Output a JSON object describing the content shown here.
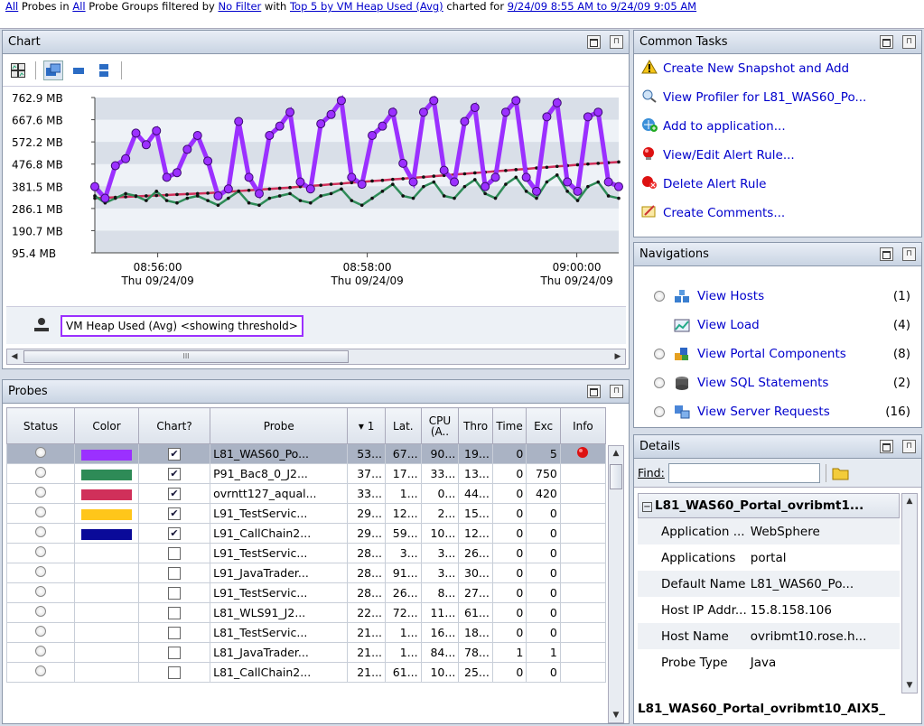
{
  "topbar": {
    "t1": "All",
    "t2": " Probes in ",
    "t3": "All",
    "t4": " Probe Groups filtered by ",
    "t5": "No Filter",
    "t6": " with ",
    "t7": "Top 5 by VM Heap Used (Avg)",
    "t8": " charted for ",
    "t9": "9/24/09 8:55 AM to 9/24/09 9:05 AM"
  },
  "chart_panel": {
    "title": "Chart",
    "legend_label": "VM Heap Used (Avg) <showing threshold>",
    "scroll_grip": "III"
  },
  "chart_data": {
    "type": "line",
    "y_ticks": [
      "762.9 MB",
      "667.6 MB",
      "572.2 MB",
      "476.8 MB",
      "381.5 MB",
      "286.1 MB",
      "190.7 MB",
      "95.4 MB"
    ],
    "x_ticks": [
      {
        "time": "08:56:00",
        "date": "Thu 09/24/09"
      },
      {
        "time": "08:58:00",
        "date": "Thu 09/24/09"
      },
      {
        "time": "09:00:00",
        "date": "Thu 09/24/09"
      }
    ],
    "ylim_mb": [
      95.4,
      762.9
    ],
    "x_range": [
      "08:55:00",
      "09:05:00"
    ],
    "series": [
      {
        "color": "#9b30ff",
        "values": [
          380,
          330,
          470,
          500,
          610,
          560,
          620,
          420,
          440,
          540,
          600,
          490,
          340,
          370,
          660,
          420,
          350,
          600,
          640,
          700,
          400,
          370,
          650,
          690,
          750,
          420,
          390,
          600,
          640,
          700,
          480,
          400,
          700,
          750,
          450,
          400,
          660,
          720,
          380,
          420,
          700,
          750,
          420,
          360,
          680,
          740,
          400,
          360,
          680,
          700,
          400,
          380
        ]
      },
      {
        "color": "#2e8b57",
        "values": [
          340,
          310,
          330,
          350,
          340,
          320,
          360,
          320,
          310,
          330,
          340,
          320,
          300,
          330,
          360,
          310,
          300,
          330,
          340,
          350,
          320,
          310,
          340,
          350,
          370,
          320,
          300,
          330,
          360,
          390,
          340,
          330,
          380,
          400,
          340,
          330,
          380,
          410,
          350,
          330,
          390,
          420,
          360,
          330,
          400,
          430,
          360,
          320,
          380,
          400,
          340,
          330
        ]
      },
      {
        "color": "#d0305a",
        "values": [
          330,
          332,
          334,
          336,
          338,
          340,
          342,
          344,
          346,
          348,
          350,
          352,
          355,
          358,
          361,
          364,
          367,
          370,
          373,
          376,
          380,
          383,
          386,
          390,
          393,
          397,
          400,
          404,
          407,
          411,
          414,
          418,
          421,
          425,
          428,
          432,
          435,
          439,
          442,
          446,
          449,
          453,
          456,
          460,
          463,
          467,
          470,
          474,
          477,
          480,
          483,
          486
        ]
      }
    ]
  },
  "probes_panel": {
    "title": "Probes",
    "columns": [
      "Status",
      "Color",
      "Chart?",
      "Probe",
      "1",
      "Lat.",
      "CPU (A..",
      "Thro",
      "Time",
      "Exc",
      "Info"
    ],
    "rows": [
      {
        "color": "#9b30ff",
        "checked": true,
        "probe": "L81_WAS60_Po...",
        "v1": "53...",
        "lat": "67...",
        "cpu": "90...",
        "thr": "19...",
        "time": "0",
        "exc": "5",
        "info": true,
        "sel": true
      },
      {
        "color": "#2e8b57",
        "checked": true,
        "probe": "P91_Bac8_0_J2...",
        "v1": "37...",
        "lat": "17...",
        "cpu": "33...",
        "thr": "13...",
        "time": "0",
        "exc": "750"
      },
      {
        "color": "#d0305a",
        "checked": true,
        "probe": "ovrntt127_aqual...",
        "v1": "33...",
        "lat": "1...",
        "cpu": "0...",
        "thr": "44...",
        "time": "0",
        "exc": "420"
      },
      {
        "color": "#ffc61a",
        "checked": true,
        "probe": "L91_TestServic...",
        "v1": "29...",
        "lat": "12...",
        "cpu": "2...",
        "thr": "15...",
        "time": "0",
        "exc": "0"
      },
      {
        "color": "#0a0a99",
        "checked": true,
        "probe": "L91_CallChain2...",
        "v1": "29...",
        "lat": "59...",
        "cpu": "10...",
        "thr": "12...",
        "time": "0",
        "exc": "0"
      },
      {
        "color": "",
        "checked": false,
        "probe": "L91_TestServic...",
        "v1": "28...",
        "lat": "3...",
        "cpu": "3...",
        "thr": "26...",
        "time": "0",
        "exc": "0"
      },
      {
        "color": "",
        "checked": false,
        "probe": "L91_JavaTrader...",
        "v1": "28...",
        "lat": "91...",
        "cpu": "3...",
        "thr": "30...",
        "time": "0",
        "exc": "0"
      },
      {
        "color": "",
        "checked": false,
        "probe": "L91_TestServic...",
        "v1": "28...",
        "lat": "26...",
        "cpu": "8...",
        "thr": "27...",
        "time": "0",
        "exc": "0"
      },
      {
        "color": "",
        "checked": false,
        "probe": "L81_WLS91_J2...",
        "v1": "22...",
        "lat": "72...",
        "cpu": "11...",
        "thr": "61...",
        "time": "0",
        "exc": "0"
      },
      {
        "color": "",
        "checked": false,
        "probe": "L81_TestServic...",
        "v1": "21...",
        "lat": "1...",
        "cpu": "16...",
        "thr": "18...",
        "time": "0",
        "exc": "0"
      },
      {
        "color": "",
        "checked": false,
        "probe": "L81_JavaTrader...",
        "v1": "21...",
        "lat": "1...",
        "cpu": "84...",
        "thr": "78...",
        "time": "1",
        "exc": "1"
      },
      {
        "color": "",
        "checked": false,
        "probe": "L81_CallChain2...",
        "v1": "21...",
        "lat": "61...",
        "cpu": "10...",
        "thr": "25...",
        "time": "0",
        "exc": "0"
      }
    ]
  },
  "tasks_panel": {
    "title": "Common Tasks",
    "items": [
      {
        "label": "Create New Snapshot and Add",
        "icon": "warning-icon"
      },
      {
        "label": "View Profiler for L81_WAS60_Po...",
        "icon": "profiler-icon"
      },
      {
        "label": "Add to application...",
        "icon": "add-application-icon"
      },
      {
        "label": "View/Edit Alert Rule...",
        "icon": "alert-rule-icon"
      },
      {
        "label": "Delete Alert Rule",
        "icon": "delete-alert-icon"
      },
      {
        "label": "Create Comments...",
        "icon": "comments-icon"
      }
    ]
  },
  "nav_panel": {
    "title": "Navigations",
    "items": [
      {
        "label": "View Hosts",
        "count": "(1)",
        "radio": true
      },
      {
        "label": "View Load",
        "count": "(4)",
        "radio": false
      },
      {
        "label": "View Portal Components",
        "count": "(8)",
        "radio": true
      },
      {
        "label": "View SQL Statements",
        "count": "(2)",
        "radio": true
      },
      {
        "label": "View Server Requests",
        "count": "(16)",
        "radio": true
      }
    ]
  },
  "details_panel": {
    "title": "Details",
    "find_label": "Find:",
    "group": "L81_WAS60_Portal_ovribmt1...",
    "props": [
      {
        "k": "Application ...",
        "v": "WebSphere"
      },
      {
        "k": "Applications",
        "v": "portal"
      },
      {
        "k": "Default Name",
        "v": "L81_WAS60_Po..."
      },
      {
        "k": "Host IP Addr...",
        "v": "15.8.158.106"
      },
      {
        "k": "Host Name",
        "v": "ovribmt10.rose.h..."
      },
      {
        "k": "Probe Type",
        "v": "Java"
      }
    ],
    "footer": "L81_WAS60_Portal_ovribmt10_AIX5_"
  }
}
